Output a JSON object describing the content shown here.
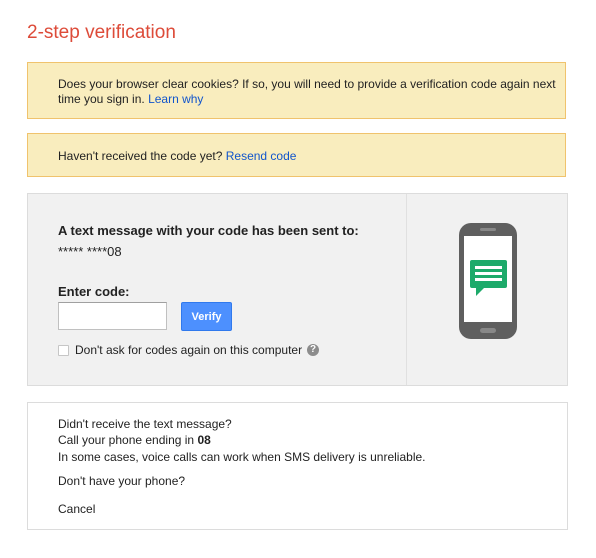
{
  "page": {
    "title": "2-step verification"
  },
  "notices": {
    "cookies_text": "Does your browser clear cookies? If so, you will need to provide a verification code again next time you sign in.",
    "cookies_link": "Learn why",
    "resend_text": "Haven't received the code yet?",
    "resend_link": "Resend code"
  },
  "verify_panel": {
    "sent_label": "A text message with your code has been sent to:",
    "masked_phone": "***** ****08",
    "enter_label": "Enter code:",
    "code_value": "",
    "code_placeholder": "",
    "verify_button": "Verify",
    "remember_label": "Don't ask for codes again on this computer",
    "help_icon_glyph": "?",
    "illustration_icon": "phone-message-icon",
    "phone_color": "#5f5f5f",
    "message_color": "#1daa6a"
  },
  "alternatives": {
    "question": "Didn't receive the text message?",
    "call_link_prefix": "Call your phone ending in ",
    "call_link_digits": "08",
    "reliability_note": "In some cases, voice calls can work when SMS delivery is unreliable.",
    "no_phone_link": "Don't have your phone?",
    "cancel_link": "Cancel"
  },
  "colors": {
    "title": "#dd4b39",
    "link": "#1155cc",
    "notice_bg": "#f9edbe",
    "notice_border": "#f0c36d",
    "button_bg": "#4d90fe"
  }
}
